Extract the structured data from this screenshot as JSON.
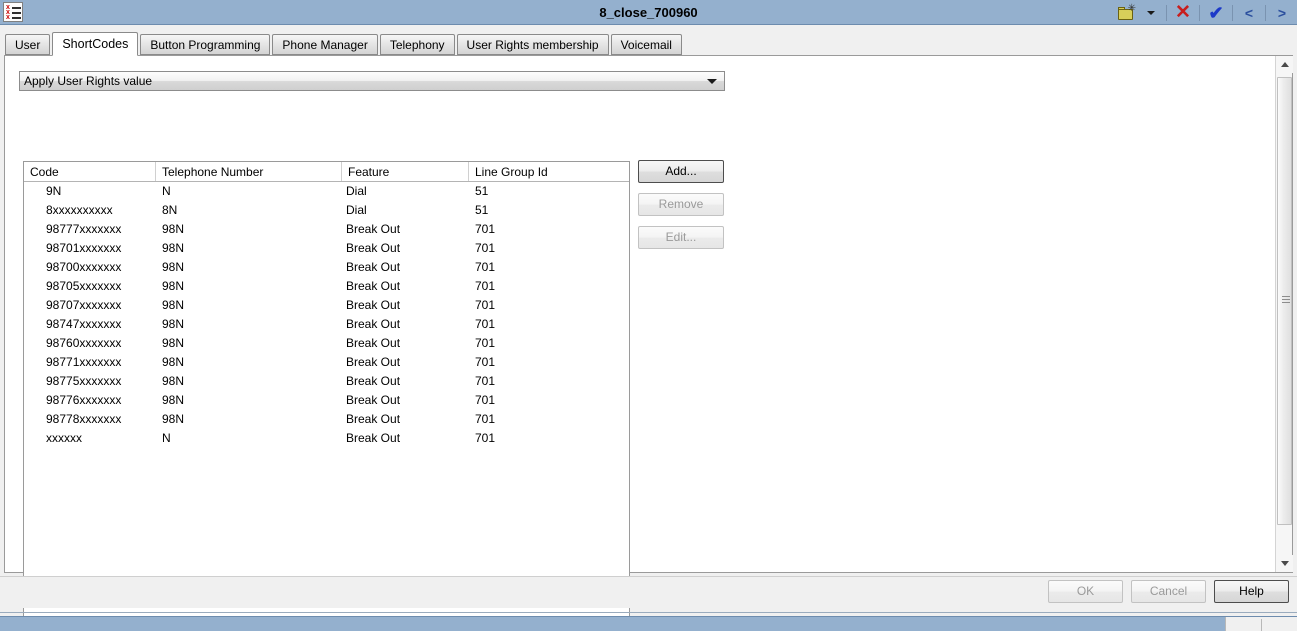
{
  "window": {
    "title": "8_close_700960",
    "app_icon": "list-document-icon"
  },
  "titlebar_tools": {
    "new_folder_label": "new-folder-icon",
    "dropdown_label": "▾",
    "delete_label": "✕",
    "confirm_label": "✔",
    "prev_label": "<",
    "next_label": ">"
  },
  "tabs": [
    {
      "label": "User",
      "active": false
    },
    {
      "label": "ShortCodes",
      "active": true
    },
    {
      "label": "Button Programming",
      "active": false
    },
    {
      "label": "Phone Manager",
      "active": false
    },
    {
      "label": "Telephony",
      "active": false
    },
    {
      "label": "User Rights membership",
      "active": false
    },
    {
      "label": "Voicemail",
      "active": false
    }
  ],
  "combo": {
    "value": "Apply User Rights value"
  },
  "table": {
    "columns": [
      "Code",
      "Telephone Number",
      "Feature",
      "Line Group Id"
    ],
    "rows": [
      {
        "code": "9N",
        "telephone": "N",
        "feature": "Dial",
        "line_group_id": "51"
      },
      {
        "code": "8xxxxxxxxxx",
        "telephone": "8N",
        "feature": "Dial",
        "line_group_id": "51"
      },
      {
        "code": "98777xxxxxxx",
        "telephone": "98N",
        "feature": "Break Out",
        "line_group_id": "701"
      },
      {
        "code": "98701xxxxxxx",
        "telephone": "98N",
        "feature": "Break Out",
        "line_group_id": "701"
      },
      {
        "code": "98700xxxxxxx",
        "telephone": "98N",
        "feature": "Break Out",
        "line_group_id": "701"
      },
      {
        "code": "98705xxxxxxx",
        "telephone": "98N",
        "feature": "Break Out",
        "line_group_id": "701"
      },
      {
        "code": "98707xxxxxxx",
        "telephone": "98N",
        "feature": "Break Out",
        "line_group_id": "701"
      },
      {
        "code": "98747xxxxxxx",
        "telephone": "98N",
        "feature": "Break Out",
        "line_group_id": "701"
      },
      {
        "code": "98760xxxxxxx",
        "telephone": "98N",
        "feature": "Break Out",
        "line_group_id": "701"
      },
      {
        "code": "98771xxxxxxx",
        "telephone": "98N",
        "feature": "Break Out",
        "line_group_id": "701"
      },
      {
        "code": "98775xxxxxxx",
        "telephone": "98N",
        "feature": "Break Out",
        "line_group_id": "701"
      },
      {
        "code": "98776xxxxxxx",
        "telephone": "98N",
        "feature": "Break Out",
        "line_group_id": "701"
      },
      {
        "code": "98778xxxxxxx",
        "telephone": "98N",
        "feature": "Break Out",
        "line_group_id": "701"
      },
      {
        "code": "xxxxxx",
        "telephone": "N",
        "feature": "Break Out",
        "line_group_id": "701"
      }
    ]
  },
  "side_buttons": {
    "add": "Add...",
    "remove": "Remove",
    "edit": "Edit..."
  },
  "footer_buttons": {
    "ok": "OK",
    "cancel": "Cancel",
    "help": "Help"
  },
  "colors": {
    "titlebar": "#94b0ce",
    "panel": "#ffffff",
    "chrome": "#f0f0f0",
    "delete_icon": "#c81e1e",
    "confirm_icon": "#1c39c8",
    "folder_icon": "#d8cf5a"
  }
}
